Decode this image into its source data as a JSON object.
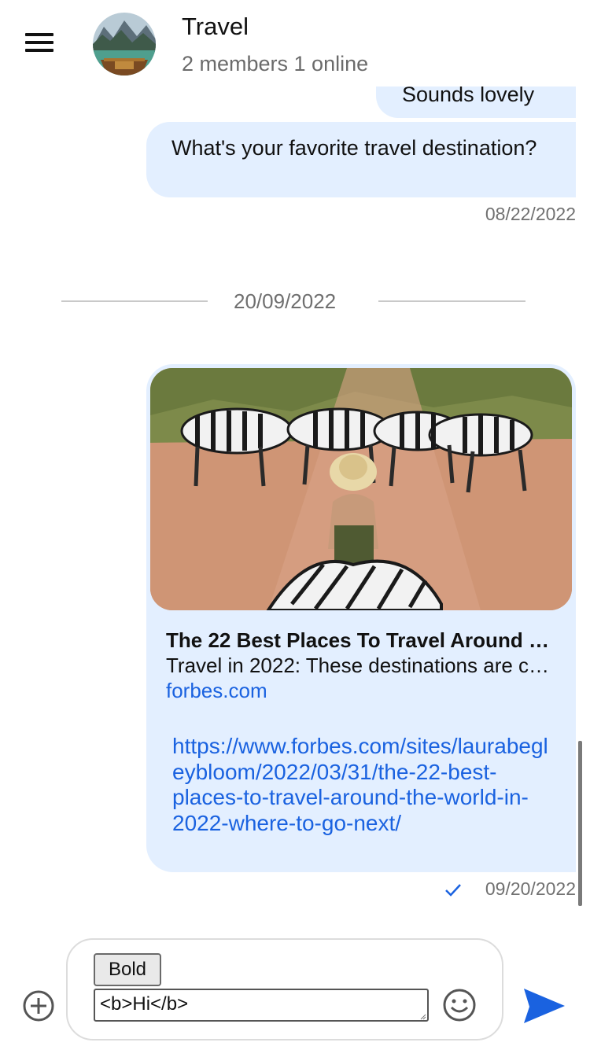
{
  "header": {
    "title": "Travel",
    "subtitle": "2 members 1 online"
  },
  "messages": [
    {
      "text": "Sounds lovely"
    },
    {
      "text": "What's your favorite travel destination?",
      "timestamp": "08/22/2022"
    }
  ],
  "date_divider": "20/09/2022",
  "link_message": {
    "preview_title": "The 22 Best Places To Travel Around The World In 2022",
    "preview_description": "Travel in 2022: These destinations are calling",
    "preview_domain": "forbes.com",
    "url": "https://www.forbes.com/sites/laurabegleybloom/2022/03/31/the-22-best-places-to-travel-around-the-world-in-2022-where-to-go-next/",
    "timestamp": "09/20/2022",
    "status": "sent"
  },
  "composer": {
    "bold_label": "Bold",
    "input_value": "<b>Hi</b>"
  },
  "colors": {
    "bubble": "#e3efff",
    "link": "#1a62e0",
    "send": "#1a62e0"
  },
  "icons": [
    "menu-icon",
    "group-avatar",
    "check-icon",
    "add-circle-icon",
    "emoji-icon",
    "send-icon"
  ]
}
